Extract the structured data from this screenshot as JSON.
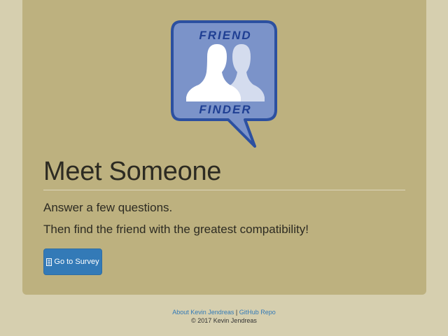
{
  "logo": {
    "top_text": "FRIEND",
    "bottom_text": "FINDER",
    "colors": {
      "bubble_fill": "#7b93c9",
      "bubble_border": "#2c50a0",
      "figure_front": "#ffffff",
      "figure_back": "#d4dcee",
      "text": "#1f3f93"
    }
  },
  "hero": {
    "heading": "Meet Someone",
    "lead_1": "Answer a few questions.",
    "lead_2": "Then find the friend with the greatest compatibility!",
    "survey_button": {
      "label": "Go to Survey",
      "icon": "list-alt-icon"
    }
  },
  "footer": {
    "about_link": "About Kevin Jendreas",
    "separator": "|",
    "github_link": "GitHub Repo",
    "copyright": "© 2017 Kevin Jendreas"
  },
  "colors": {
    "page_bg": "#d6cfaf",
    "panel_bg": "#bdb17f",
    "button_bg": "#337ab7",
    "link": "#337ab7"
  }
}
